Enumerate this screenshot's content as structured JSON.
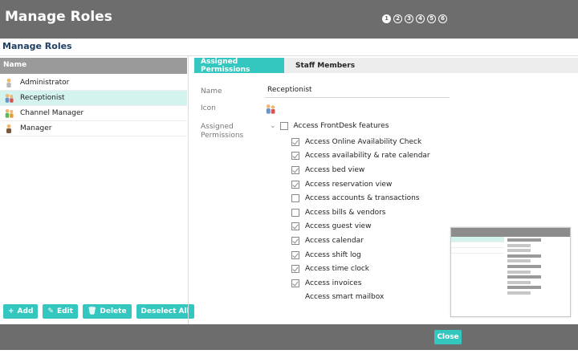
{
  "window": {
    "title": "Manage Roles",
    "steps": [
      "1",
      "2",
      "3",
      "4",
      "5",
      "6"
    ],
    "active_step": 1
  },
  "subtitle": "Manage Roles",
  "roles_panel": {
    "header": "Name",
    "items": [
      {
        "label": "Administrator",
        "icon": "administrator-icon"
      },
      {
        "label": "Receptionist",
        "icon": "receptionist-icon",
        "selected": true
      },
      {
        "label": "Channel Manager",
        "icon": "channel-manager-icon"
      },
      {
        "label": "Manager",
        "icon": "manager-icon"
      }
    ],
    "buttons": [
      {
        "label": "Add",
        "icon": "+"
      },
      {
        "label": "Edit",
        "icon": "✎"
      },
      {
        "label": "Delete",
        "icon": "🗑"
      },
      {
        "label": "Deselect All",
        "icon": ""
      }
    ]
  },
  "tabs": [
    {
      "label": "Assigned Permissions",
      "active": true
    },
    {
      "label": "Staff Members",
      "active": false
    }
  ],
  "form": {
    "name_label": "Name",
    "name_value": "Receptionist",
    "icon_label": "Icon",
    "permissions_label_1": "Assigned",
    "permissions_label_2": "Permissions"
  },
  "permissions": {
    "root": {
      "label": "Access FrontDesk features",
      "checked": false
    },
    "items": [
      {
        "label": "Access Online Availability Check",
        "checked": true
      },
      {
        "label": "Access  availability & rate calendar",
        "checked": true
      },
      {
        "label": "Access bed view",
        "checked": true
      },
      {
        "label": "Access reservation view",
        "checked": true
      },
      {
        "label": "Access accounts & transactions",
        "checked": false
      },
      {
        "label": "Access bills & vendors",
        "checked": false
      },
      {
        "label": "Access guest view",
        "checked": true
      },
      {
        "label": "Access calendar",
        "checked": true
      },
      {
        "label": "Access shift log",
        "checked": true
      },
      {
        "label": "Access time clock",
        "checked": true
      },
      {
        "label": "Access invoices",
        "checked": true
      },
      {
        "label": "Access smart mailbox",
        "checked": null
      }
    ]
  },
  "footer": {
    "close_label": "Close"
  },
  "colors": {
    "accent": "#33c7bf",
    "titlebar": "#6d6d6d",
    "selected_row": "#d4f3ef",
    "heading": "#1f3f63"
  }
}
